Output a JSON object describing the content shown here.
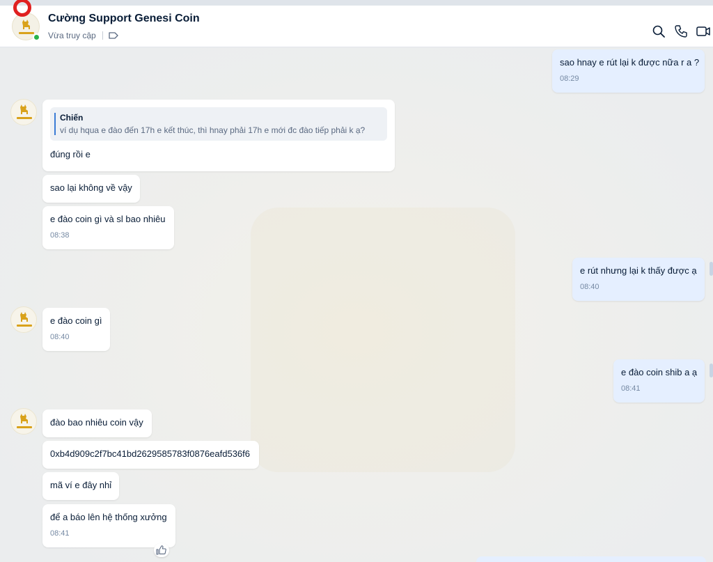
{
  "header": {
    "contact_name": "Cường Support Genesi Coin",
    "status": "Vừa truy cập",
    "online": true
  },
  "colors": {
    "accent": "#3a7bd5",
    "incoming_bubble": "#ffffff",
    "outgoing_bubble": "#e5efff",
    "online": "#29b34b"
  },
  "icons": [
    "search-icon",
    "phone-icon",
    "video-call-icon",
    "tag-icon",
    "like-icon"
  ],
  "messages": [
    {
      "dir": "out",
      "text": "sao hnay e rút lại k được nữa r a ?",
      "time": "08:29"
    },
    {
      "dir": "in",
      "quote_author": "Chiến",
      "quote_text": "ví dụ hqua e đào đến 17h e kết thúc, thì hnay phải 17h e mới đc đào tiếp phải k ạ?",
      "text": "đúng rồi e"
    },
    {
      "dir": "in",
      "text": "sao lại không về vậy"
    },
    {
      "dir": "in",
      "text": "e đào coin gì và sl bao nhiêu",
      "time": "08:38"
    },
    {
      "dir": "out",
      "text": "e rút nhưng lại k thấy được ạ",
      "time": "08:40"
    },
    {
      "dir": "in",
      "text": "e đào coin gì",
      "time": "08:40"
    },
    {
      "dir": "out",
      "text": "e đào coin shib a ạ",
      "time": "08:41"
    },
    {
      "dir": "in",
      "text": "đào bao nhiêu coin vậy"
    },
    {
      "dir": "in",
      "text": "0xb4d909c2f7bc41bd2629585783f0876eafd536f6"
    },
    {
      "dir": "in",
      "text": "mã ví e đây nhỉ"
    },
    {
      "dir": "in",
      "text": "để a báo lên hệ thống xưởng",
      "time": "08:41"
    }
  ]
}
